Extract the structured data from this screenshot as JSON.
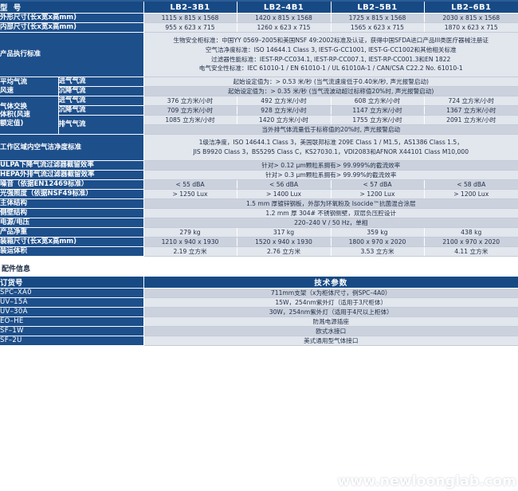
{
  "models": [
    "LB2–3B1",
    "LB2–4B1",
    "LB2–5B1",
    "LB2–6B1"
  ],
  "spec_table": {
    "model_header_label": "型  号",
    "rows": [
      {
        "label": "外形尺寸(长x宽x高mm)",
        "values": [
          "1115 x 815 x 1568",
          "1420 x 815 x 1568",
          "1725 x 815 x 1568",
          "2030 x 815 x 1568"
        ]
      },
      {
        "label": "内部尺寸(长x宽x高mm)",
        "values": [
          "955 x 623 x 715",
          "1260 x 623 x 715",
          "1565 x 623 x 715",
          "1870 x 623 x 715"
        ]
      }
    ],
    "standards": {
      "label": "产品执行标准",
      "lines": [
        "生物安全柜标准：中国YY 0569–2005和美国NSF 49:2002标准及认证，获得中国SFDA进口产品III类医疗器械注册证",
        "空气洁净度标准：ISO 14644.1 Class 3, IEST-G-CC1001, IEST-G-CC1002和其他相关标准",
        "过滤器性能标准：IEST-RP-CC034.1, IEST-RP-CC007.1, IEST-RP-CC001.3和EN 1822",
        "电气安全性标准：IEC 61010-1 / EN 61010-1 / UL 61010A-1 / CAN/CSA C22.2 No. 61010-1"
      ]
    },
    "airflow_velocity": {
      "group_label": "平均气流\n风速",
      "group_label_line1": "平均气流",
      "group_label_line2": "风速",
      "rows": [
        {
          "label": "进气气流",
          "value": "起始设定值为：> 0.53 米/秒 (当气流速度低于0.40米/秒, 声光报警启动)"
        },
        {
          "label": "沉降气流",
          "value": "起始设定值为：> 0.35 米/秒 (当气流波动超过标称值20%时, 声光报警启动)"
        }
      ]
    },
    "gas_exchange": {
      "group_label_line1": "气体交换",
      "group_label_line2": "体积(风速",
      "group_label_line3": "额定值)",
      "rows": [
        {
          "label": "进气气流",
          "values": [
            "376 立方米/小时",
            "492 立方米/小时",
            "608 立方米/小时",
            "724 立方米/小时"
          ]
        },
        {
          "label": "沉降气流",
          "values": [
            "709 立方米/小时",
            "928 立方米/小时",
            "1147 立方米/小时",
            "1367 立方米/小时"
          ]
        },
        {
          "label": "排气气流",
          "values": [
            "1085 立方米/小时",
            "1420 立方米/小时",
            "1755 立方米/小时",
            "2091 立方米/小时"
          ],
          "note": "当外排气体流量低于标称值的20%时, 声光报警启动"
        }
      ]
    },
    "cleanliness": {
      "label": "工作区域内空气洁净度标准",
      "lines": [
        "1级洁净度，ISO 14644.1 Class 3，美国联邦标准 209E Class 1 / M1.5，AS1386 Class 1.5，",
        "JIS B9920 Class 3，BS5295 Class C，KS27030.1，VDI2083和AFNOR X44101 Class M10,000"
      ]
    },
    "filters": [
      {
        "label": "ULPA下降气流过滤器截留效率",
        "value": "针对> 0.12 μm颗粒系拥有> 99.999%的截流效率"
      },
      {
        "label": "HEPA外排气流过滤器截留效率",
        "value": "针对> 0.3 μm颗粒系拥有> 99.99%的截流效率"
      }
    ],
    "noise": {
      "label": "噪音（依据EN12469标准）",
      "values": [
        "< 55 dBA",
        "< 56 dBA",
        "< 57 dBA",
        "< 58 dBA"
      ]
    },
    "illumination": {
      "label": "光强照度（依据NSF49标准）",
      "values": [
        "> 1250 Lux",
        "> 1400 Lux",
        "> 1200 Lux",
        "> 1200 Lux"
      ]
    },
    "body_structure": {
      "label": "主体结构",
      "value": "1.5 mm 厚镀锌钢板，外部为环氧粉及 Isocide™抗菌混合涂层"
    },
    "side_wall": {
      "label": "侧壁结构",
      "value": "1.2 mm 厚 304# 不锈钢侧壁，双层负压腔设计"
    },
    "power": {
      "label": "电源/电压",
      "value": "220–240 V / 50 Hz，单相"
    },
    "net_weight": {
      "label": "产品净重",
      "values": [
        "279 kg",
        "317 kg",
        "359 kg",
        "438 kg"
      ]
    },
    "packing_size": {
      "label": "装箱尺寸(长x宽x高mm)",
      "values": [
        "1210 x 940 x 1930",
        "1520 x 940 x 1930",
        "1800 x 970 x 2020",
        "2100 x 970 x 2020"
      ]
    },
    "shipping_volume": {
      "label": "装运体积",
      "values": [
        "2.19 立方米",
        "2.76 立方米",
        "3.53 立方米",
        "4.11 立方米"
      ]
    }
  },
  "accessories": {
    "title": "配件信息",
    "headers": [
      "订货号",
      "技术参数"
    ],
    "rows": [
      {
        "code": "SPC–XA0",
        "spec": "711mm支架（x为柜体尺寸，例SPC–4A0）"
      },
      {
        "code": "UV–15A",
        "spec": "15W，254nm紫外灯（适用于3尺柜体）"
      },
      {
        "code": "UV–30A",
        "spec": "30W，254nm紫外灯（适用于4尺以上柜体）"
      },
      {
        "code": "EO–HE",
        "spec": "防溅电源插座"
      },
      {
        "code": "SF–1W",
        "spec": "欧式水接口"
      },
      {
        "code": "SF–2U",
        "spec": "美式通用型气体接口"
      }
    ]
  },
  "watermark": "www.newloonglab.com",
  "colors": {
    "header_blue": "#174a85",
    "label_blue": "#1d4f8b",
    "row_dark": "#ccd2dd",
    "row_light": "#e2e6ed",
    "text": "#21304a"
  }
}
